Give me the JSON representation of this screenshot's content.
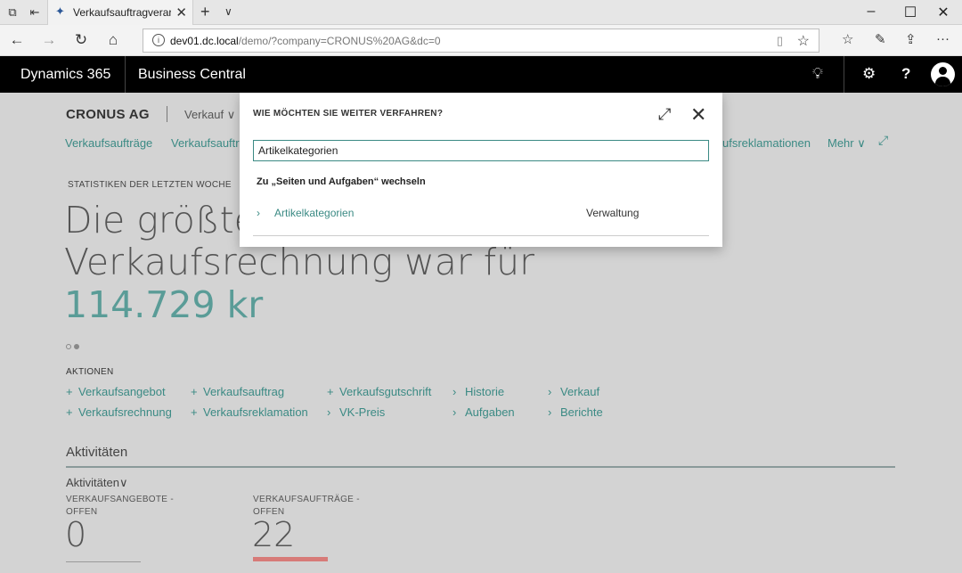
{
  "browser": {
    "tab_title": "Verkaufsauftragverarbei",
    "address": "dev01.dc.local",
    "address_path": "/demo/?company=CRONUS%20AG&dc=0"
  },
  "d365": {
    "brand": "Dynamics 365",
    "product": "Business Central"
  },
  "page": {
    "company": "CRONUS AG",
    "company_menu": "Verkauf",
    "nav": [
      "Verkaufsaufträge",
      "Verkaufsaufträ",
      "ufsreklamationen",
      "Mehr"
    ],
    "headline_label": "STATISTIKEN DER LETZTEN WOCHE",
    "headline_line1": "Die größte",
    "headline_line2": "Verkaufsrechnung war für",
    "headline_value": "114.729 kr",
    "actions_title": "AKTIONEN",
    "actions": {
      "a1": "Verkaufsangebot",
      "a2": "Verkaufsauftrag",
      "a3": "Verkaufsgutschrift",
      "a4": "Historie",
      "a5": "Verkauf",
      "a6": "Verkaufsrechnung",
      "a7": "Verkaufsreklamation",
      "a8": "VK-Preis",
      "a9": "Aufgaben",
      "a10": "Berichte"
    },
    "section_title": "Aktivitäten",
    "sub_title": "Aktivitäten",
    "tiles": [
      {
        "label": "VERKAUFSANGEBOTE - OFFEN",
        "value": "0"
      },
      {
        "label": "VERKAUFSAUFTRÄGE - OFFEN",
        "value": "22"
      }
    ]
  },
  "dialog": {
    "title": "WIE MÖCHTEN SIE WEITER VERFAHREN?",
    "search_value": "Artikelkategorien",
    "group_label": "Zu „Seiten und Aufgaben“ wechseln",
    "result_name": "Artikelkategorien",
    "result_category": "Verwaltung"
  }
}
